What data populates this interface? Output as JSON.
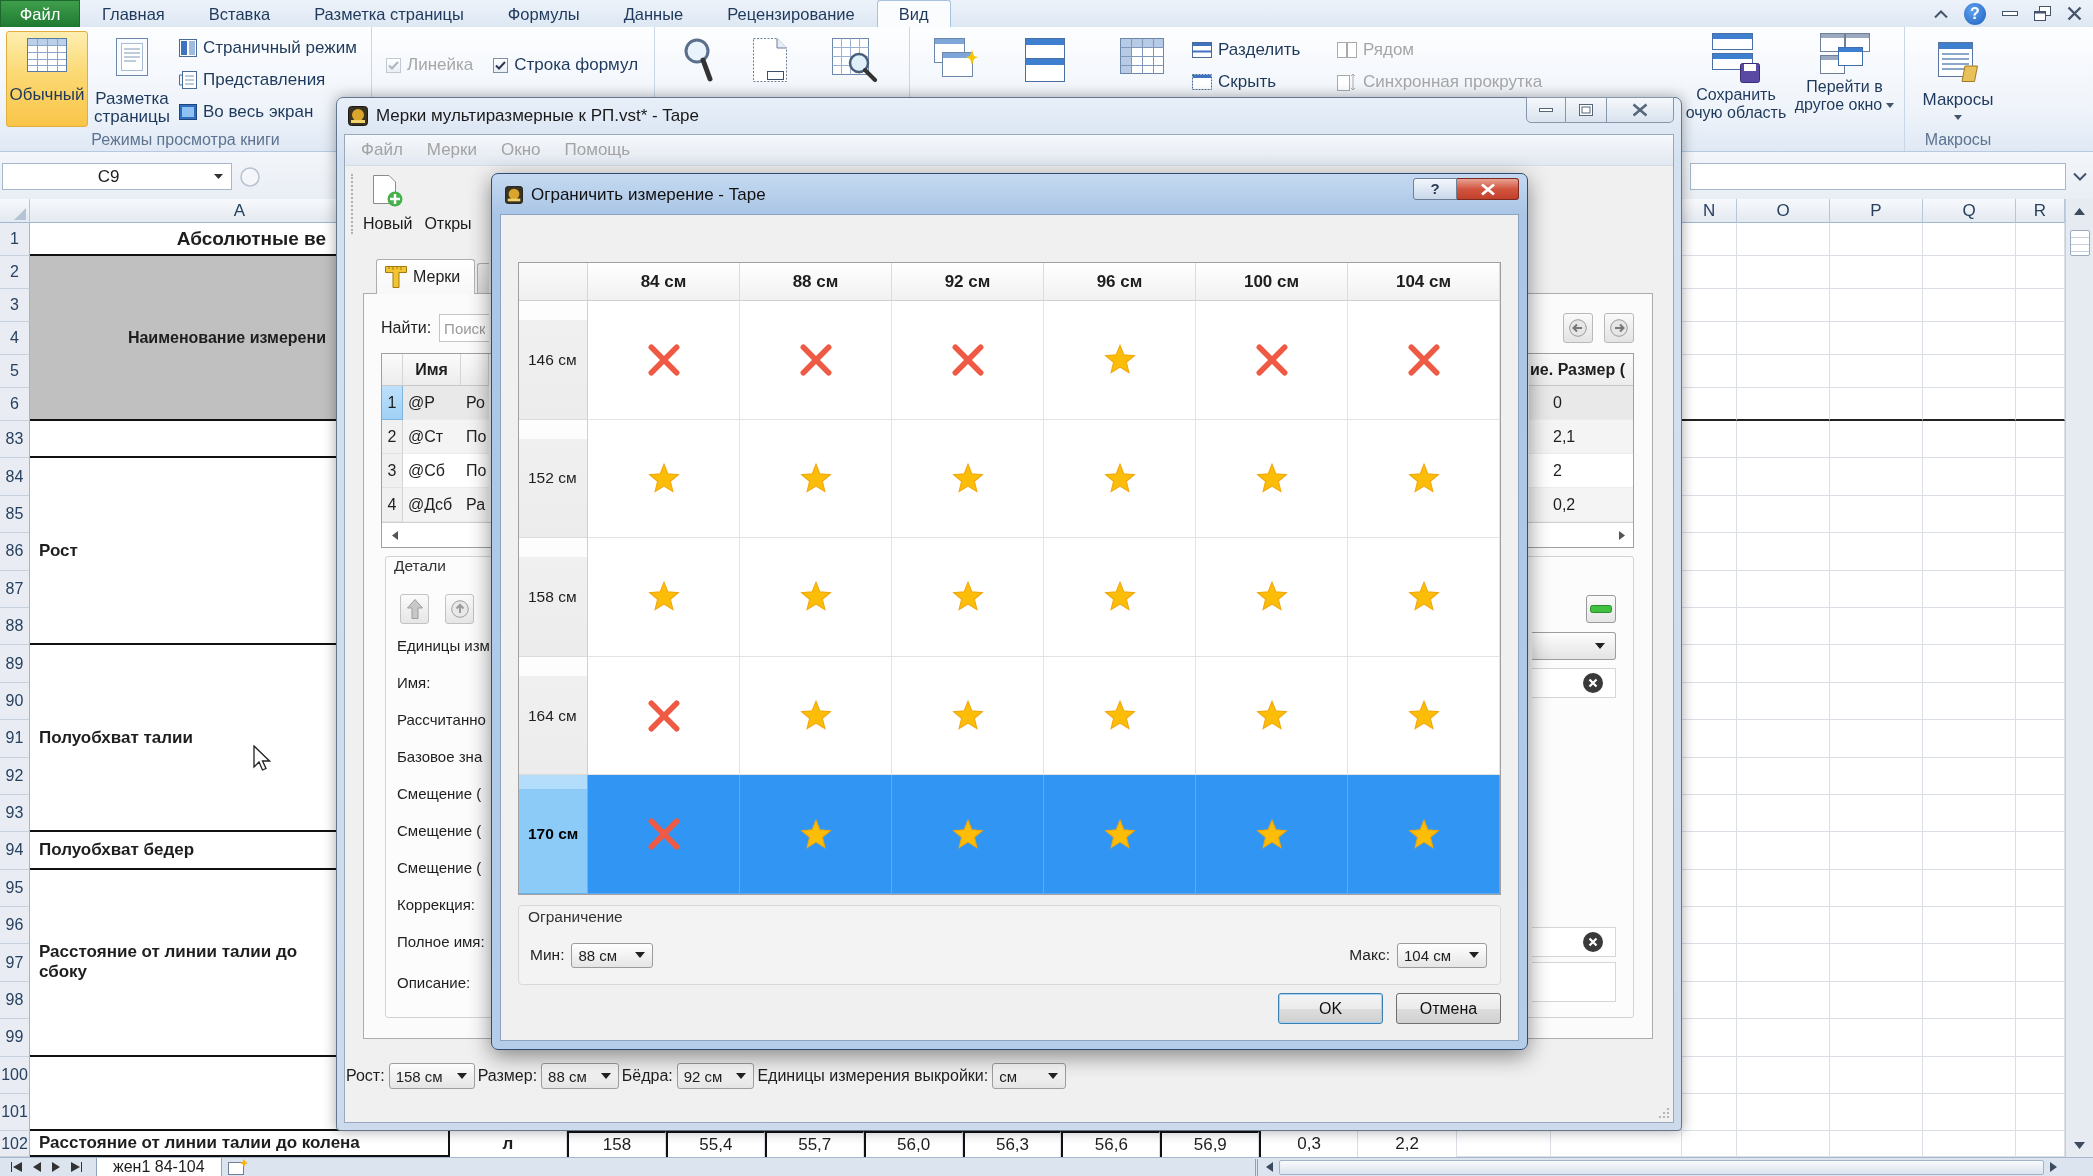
{
  "excel": {
    "ribbon_tabs": [
      {
        "label": "Файл",
        "kind": "file",
        "selected": false
      },
      {
        "label": "Главная",
        "kind": "tab",
        "selected": false
      },
      {
        "label": "Вставка",
        "kind": "tab",
        "selected": false
      },
      {
        "label": "Разметка страницы",
        "kind": "tab",
        "selected": false
      },
      {
        "label": "Формулы",
        "kind": "tab",
        "selected": false
      },
      {
        "label": "Данные",
        "kind": "tab",
        "selected": false
      },
      {
        "label": "Рецензирование",
        "kind": "tab",
        "selected": false
      },
      {
        "label": "Вид",
        "kind": "tab",
        "selected": true
      }
    ],
    "help_glyph": "?",
    "view_modes": {
      "large_buttons": [
        {
          "label": "Обычный",
          "selected": true
        },
        {
          "label": "Разметка страницы",
          "selected": false
        }
      ],
      "small_buttons": [
        "Страничный режим",
        "Представления",
        "Во весь экран"
      ],
      "group_label": "Режимы просмотра книги"
    },
    "show_options": [
      {
        "label": "Линейка",
        "checked": true,
        "disabled": true
      },
      {
        "label": "Строка формул",
        "checked": true,
        "disabled": false
      }
    ],
    "window_options": [
      {
        "label": "Разделить",
        "disabled": false
      },
      {
        "label": "Скрыть",
        "disabled": false
      },
      {
        "label": "Рядом",
        "disabled": true
      },
      {
        "label": "Синхронная прокрутка",
        "disabled": true
      }
    ],
    "workspace_buttons": [
      {
        "label": "Сохранить\nочую область",
        "dropdown": false
      },
      {
        "label": "Перейти в\nдругое окно",
        "dropdown": true
      }
    ],
    "macros": {
      "label": "Макросы",
      "dropdown": true,
      "group_label": "Макросы"
    },
    "name_box": "C9",
    "sheet": {
      "columns_left": [
        "A"
      ],
      "columns_right": [
        "N",
        "O",
        "P",
        "Q",
        "R"
      ],
      "blocks": [
        {
          "kind": "title",
          "rows": [
            "1"
          ],
          "text": "Абсолютные ве"
        },
        {
          "kind": "header",
          "rows": [
            "2",
            "3",
            "4",
            "5",
            "6"
          ],
          "text": "Наименование измерени"
        },
        {
          "kind": "data",
          "rows": [
            "83"
          ]
        },
        {
          "kind": "data",
          "rows": [
            "84",
            "85",
            "86",
            "87",
            "88"
          ],
          "text": "Рост"
        },
        {
          "kind": "data",
          "rows": [
            "89",
            "90",
            "91",
            "92",
            "93"
          ],
          "text": "Полуобхват талии"
        },
        {
          "kind": "data",
          "rows": [
            "94"
          ],
          "text": "Полуобхват бедер"
        },
        {
          "kind": "data",
          "rows": [
            "95",
            "96",
            "97",
            "98",
            "99"
          ],
          "text": "Расстояние от линии талии до\nсбоку"
        },
        {
          "kind": "data",
          "rows": [
            "100",
            "101"
          ]
        },
        {
          "kind": "data",
          "rows": [
            "102"
          ],
          "text": "Расстояние от линии талии до колена",
          "values": [
            "л",
            "158",
            "55,4",
            "55,7",
            "56,0",
            "56,3",
            "56,6",
            "56,9",
            "0,3",
            "2,2"
          ]
        }
      ]
    },
    "sheet_tab": "жен1 84-104"
  },
  "tape": {
    "title": "Мерки мультиразмерные к РП.vst* - Tape",
    "menu": [
      {
        "label": "Файл",
        "disabled": true
      },
      {
        "label": "Мерки",
        "disabled": true
      },
      {
        "label": "Окно",
        "disabled": true
      },
      {
        "label": "Помощь",
        "disabled": true
      }
    ],
    "toolbar": [
      "Новый",
      "Откры"
    ],
    "tabs": [
      {
        "label": "Мерки",
        "selected": true
      },
      {
        "selected": false
      }
    ],
    "search": {
      "label": "Найти:",
      "placeholder": "Поиск"
    },
    "table": {
      "name_header": "Имя",
      "value_header": "ие. Размер (",
      "rows": [
        {
          "number": "1",
          "name": "@Р",
          "column_3": "Ро",
          "value": "0",
          "selected": true
        },
        {
          "number": "2",
          "name": "@Ст",
          "column_3": "По",
          "value": "2,1",
          "selected": false
        },
        {
          "number": "3",
          "name": "@Сб",
          "column_3": "По",
          "value": "2",
          "selected": false
        },
        {
          "number": "4",
          "name": "@Дсб",
          "column_3": "Ра",
          "value": "0,2",
          "selected": false
        }
      ]
    },
    "details": {
      "title": "Детали",
      "fields": [
        {
          "label": "Единицы изм",
          "kind": "combo"
        },
        {
          "label": "Имя:",
          "kind": "field"
        },
        {
          "label": "Рассчитанно",
          "kind": "label"
        },
        {
          "label": "Базовое зна",
          "kind": "label"
        },
        {
          "label": "Смещение (",
          "kind": "label"
        },
        {
          "label": "Смещение (",
          "kind": "label"
        },
        {
          "label": "Смещение (",
          "kind": "label"
        },
        {
          "label": "Коррекция:",
          "kind": "label"
        },
        {
          "label": "Полное имя:",
          "kind": "field"
        },
        {
          "label": "Описание:",
          "kind": "textarea"
        }
      ]
    },
    "bottom_bar": [
      {
        "label": "Рост:",
        "value": "158 см"
      },
      {
        "label": "Размер:",
        "value": "88 см"
      },
      {
        "label": "Бёдра:",
        "value": "92 см"
      },
      {
        "label": "Единицы измерения выкройки:",
        "value": "см"
      }
    ]
  },
  "dialog": {
    "title": "Ограничить измерение - Tape",
    "help_button": "?",
    "columns": [
      "84 см",
      "88 см",
      "92 см",
      "96 см",
      "100 см",
      "104 см"
    ],
    "rows": [
      {
        "label": "146 см",
        "selected": false,
        "cells": [
          {
            "allowed": false
          },
          {
            "allowed": false
          },
          {
            "allowed": false
          },
          {
            "allowed": true
          },
          {
            "allowed": false
          },
          {
            "allowed": false
          }
        ]
      },
      {
        "label": "152 см",
        "selected": false,
        "cells": [
          {
            "allowed": true
          },
          {
            "allowed": true
          },
          {
            "allowed": true
          },
          {
            "allowed": true
          },
          {
            "allowed": true
          },
          {
            "allowed": true
          }
        ]
      },
      {
        "label": "158 см",
        "selected": false,
        "cells": [
          {
            "allowed": true
          },
          {
            "allowed": true
          },
          {
            "allowed": true
          },
          {
            "allowed": true
          },
          {
            "allowed": true
          },
          {
            "allowed": true
          }
        ]
      },
      {
        "label": "164 см",
        "selected": false,
        "cells": [
          {
            "allowed": false
          },
          {
            "allowed": true
          },
          {
            "allowed": true
          },
          {
            "allowed": true
          },
          {
            "allowed": true
          },
          {
            "allowed": true
          }
        ]
      },
      {
        "label": "170 см",
        "selected": true,
        "cells": [
          {
            "allowed": false
          },
          {
            "allowed": true
          },
          {
            "allowed": true
          },
          {
            "allowed": true
          },
          {
            "allowed": true
          },
          {
            "allowed": true
          }
        ]
      }
    ],
    "group_title": "Ограничение",
    "min": {
      "label": "Мин:",
      "value": "88 см"
    },
    "max": {
      "label": "Макс:",
      "value": "104 см"
    },
    "buttons": [
      {
        "label": "OK",
        "default": true
      },
      {
        "label": "Отмена",
        "default": false
      }
    ]
  }
}
